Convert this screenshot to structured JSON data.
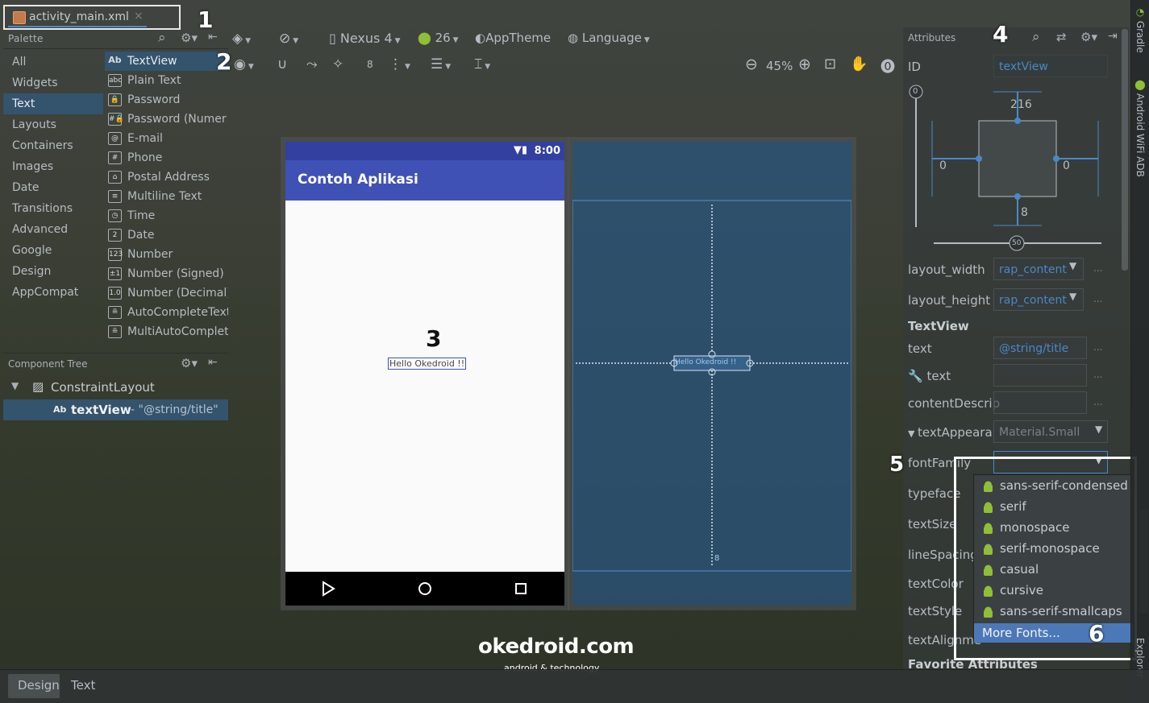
{
  "editor_tab": {
    "file_name": "activity_main.xml",
    "close": "×"
  },
  "annotations": {
    "n1": "1",
    "n2": "2",
    "n3": "3",
    "n4": "4",
    "n5": "5",
    "n6": "6"
  },
  "palette": {
    "title": "Palette",
    "categories": [
      "All",
      "Widgets",
      "Text",
      "Layouts",
      "Containers",
      "Images",
      "Date",
      "Transitions",
      "Advanced",
      "Google",
      "Design",
      "AppCompat"
    ],
    "selected_category": "Text",
    "widgets": [
      {
        "icon": "Ab",
        "label": "TextView"
      },
      {
        "icon": "abc",
        "label": "Plain Text"
      },
      {
        "icon": "🔒",
        "label": "Password"
      },
      {
        "icon": "#🔒",
        "label": "Password (Numer"
      },
      {
        "icon": "@",
        "label": "E-mail"
      },
      {
        "icon": "#",
        "label": "Phone"
      },
      {
        "icon": "⌂",
        "label": "Postal Address"
      },
      {
        "icon": "≡",
        "label": "Multiline Text"
      },
      {
        "icon": "◷",
        "label": "Time"
      },
      {
        "icon": "2",
        "label": "Date"
      },
      {
        "icon": "123",
        "label": "Number"
      },
      {
        "icon": "±1",
        "label": "Number (Signed)"
      },
      {
        "icon": "1.0",
        "label": "Number (Decimal)"
      },
      {
        "icon": "≞",
        "label": "AutoCompleteText"
      },
      {
        "icon": "≞",
        "label": "MultiAutoComplet"
      }
    ]
  },
  "component_tree": {
    "title": "Component Tree",
    "root": "ConstraintLayout",
    "child_icon": "Ab",
    "child_name": "textView",
    "child_value": "- \"@string/title\""
  },
  "toolbar": {
    "device": "Nexus 4",
    "api": "26",
    "theme": "AppTheme",
    "language": "Language",
    "margin": "8",
    "zoom": "45%"
  },
  "preview": {
    "status_time": "8:00",
    "app_title": "Contoh Aplikasi",
    "hello_text": "Hello Okedroid !!",
    "blueprint_hello": "Hello Okedroid !!",
    "bottom_margin": "8"
  },
  "attributes": {
    "title": "Attributes",
    "id_label": "ID",
    "id_value": "textView",
    "constraint_top": "216",
    "constraint_left": "0",
    "constraint_right": "0",
    "constraint_bottom": "8",
    "vertical_bias": "0",
    "horizontal_bias": "50",
    "layout_width_label": "layout_width",
    "layout_width_value": "rap_content",
    "layout_height_label": "layout_height",
    "layout_height_value": "rap_content",
    "section_title": "TextView",
    "text_label": "text",
    "text_value": "@string/title",
    "tools_text_label": "text",
    "content_desc_label": "contentDescrip",
    "text_appearance_label": "textAppeara",
    "text_appearance_value": "Material.Small",
    "font_family_label": "fontFamily",
    "typeface_label": "typeface",
    "text_size_label": "textSize",
    "line_spacing_label": "lineSpacing",
    "text_color_label": "textColor",
    "text_style_label": "textStyle",
    "text_align_label": "textAlignme",
    "favorite_label": "Favorite Attributes",
    "more": "..."
  },
  "font_dropdown": {
    "items": [
      "sans-serif-condensed",
      "serif",
      "monospace",
      "serif-monospace",
      "casual",
      "cursive",
      "sans-serif-smallcaps"
    ],
    "more_fonts": "More Fonts..."
  },
  "bottom_tabs": {
    "design": "Design",
    "text": "Text"
  },
  "side_tools": {
    "gradle": "Gradle",
    "wifi_adb": "Android WiFi ADB",
    "explorer": "Explorer"
  },
  "watermark": {
    "brand": "okedroid.com",
    "tagline": "android & technology"
  },
  "colors": {
    "accent": "#4a88c7",
    "selection": "#34536d",
    "app_bar": "#3f51b5",
    "dropdown_selected": "#4d78b8",
    "android_green": "#8fbf36"
  }
}
